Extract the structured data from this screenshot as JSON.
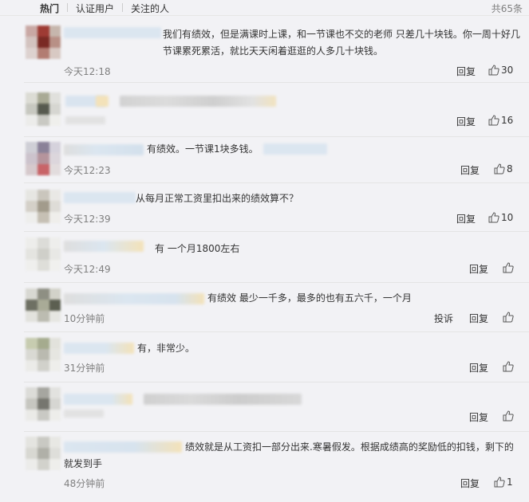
{
  "tabs": [
    {
      "label": "热门"
    },
    {
      "label": "认证用户"
    },
    {
      "label": "关注的人"
    }
  ],
  "total_label": "共65条",
  "reply_label": "回复",
  "report_label": "投诉",
  "colors": {
    "muted": "#808080",
    "text": "#333333",
    "divider": "#e4e4e4",
    "background": "#f2f2f5"
  },
  "comments": [
    {
      "text_lines": [
        "我们有绩效，但是满课时上课，和一节课也不交的老师 只差几十块钱。你一周十好几",
        "节课累死累活，就比天天闲着逛逛的人多几十块钱。"
      ],
      "time": "今天12:18",
      "likes": "30"
    },
    {
      "text_lines": [],
      "time": "",
      "likes": "16"
    },
    {
      "text_lines": [
        "有绩效。一节课1块多钱。"
      ],
      "time": "今天12:23",
      "likes": "8"
    },
    {
      "text_lines": [
        "从每月正常工资里扣出来的绩效算不？"
      ],
      "time": "今天12:39",
      "likes": "10"
    },
    {
      "text_lines": [
        "有 一个月1800左右"
      ],
      "time": "今天12:49",
      "likes": ""
    },
    {
      "text_lines": [
        "有绩效 最少一千多，最多的也有五六千，一个月"
      ],
      "time": "10分钟前",
      "likes": "",
      "report": true
    },
    {
      "text_lines": [
        "有，非常少。"
      ],
      "time": "31分钟前",
      "likes": ""
    },
    {
      "text_lines": [],
      "time": "",
      "likes": ""
    },
    {
      "text_lines": [
        "绩效就是从工资扣一部分出来.寒暑假发。根据成绩高的奖励低的扣钱，剩下的",
        "就发到手"
      ],
      "time": "48分钟前",
      "likes": "1"
    }
  ]
}
